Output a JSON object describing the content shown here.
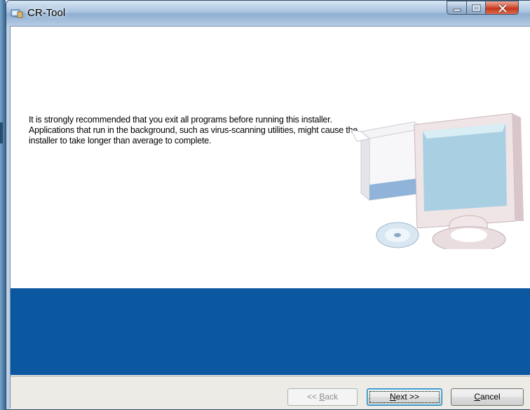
{
  "window": {
    "title": "CR-Tool"
  },
  "content": {
    "message": "It is strongly recommended that you exit all programs before running this installer. Applications that run in the background, such as virus-scanning utilities, might cause the installer to take longer than average to complete."
  },
  "buttons": {
    "back_prefix": "<< ",
    "back_mnemonic": "B",
    "back_rest": "ack",
    "next_mnemonic": "N",
    "next_rest": "ext >>",
    "cancel_mnemonic": "C",
    "cancel_rest": "ancel"
  },
  "colors": {
    "banner_blue": "#0c58a0",
    "close_red": "#c4361c"
  },
  "icons": {
    "title": "installer-app-icon",
    "illustration": "computer-with-box-and-cd-illustration"
  }
}
